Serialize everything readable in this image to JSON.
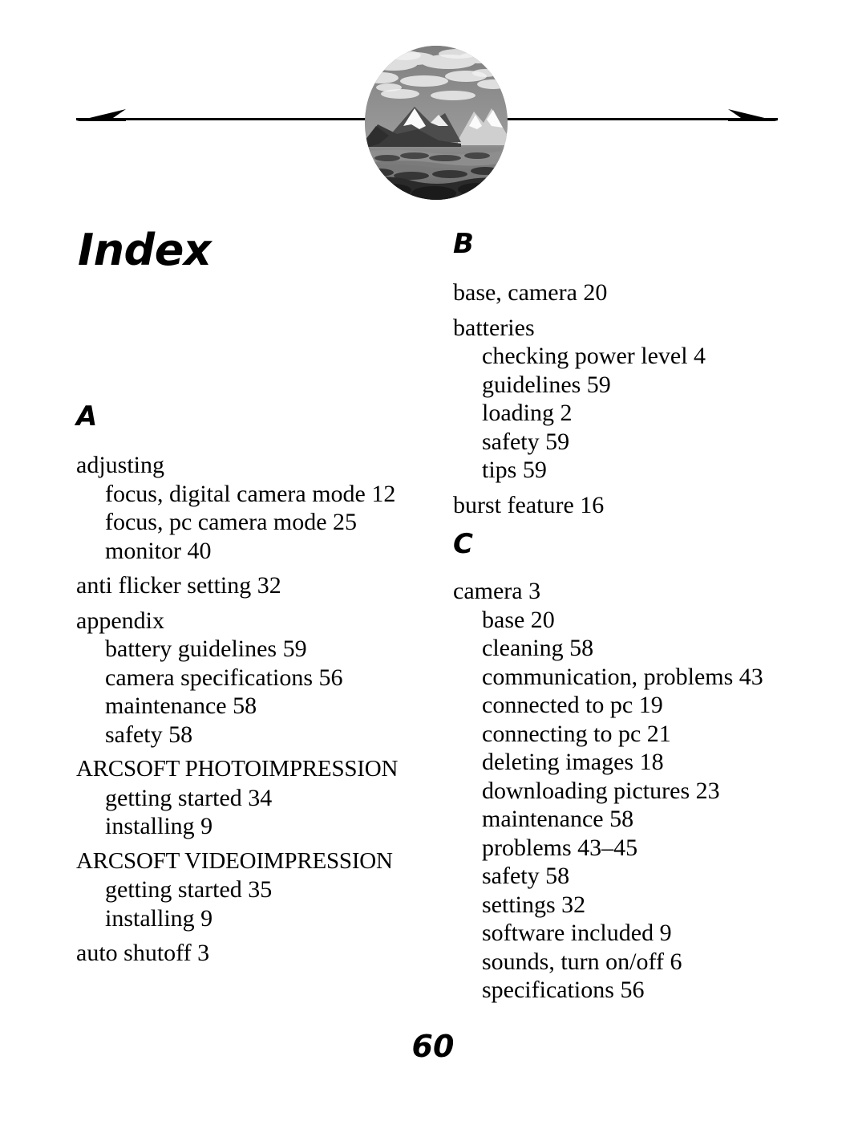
{
  "header": {
    "photo_alt": "mountain-landscape-photo",
    "left_arrow": "arrow-left",
    "right_arrow": "arrow-right"
  },
  "title": "Index",
  "page_number": "60",
  "columns": {
    "left": {
      "sections": [
        {
          "letter": "A",
          "groups": [
            {
              "entries": [
                {
                  "level": 1,
                  "text": "adjusting"
                },
                {
                  "level": 2,
                  "text": "focus, digital camera mode 12"
                },
                {
                  "level": 2,
                  "text": "focus, pc camera mode 25"
                },
                {
                  "level": 2,
                  "text": "monitor 40"
                }
              ]
            },
            {
              "entries": [
                {
                  "level": 1,
                  "text": "anti flicker setting 32"
                }
              ]
            },
            {
              "entries": [
                {
                  "level": 1,
                  "text": "appendix"
                },
                {
                  "level": 2,
                  "text": "battery guidelines 59"
                },
                {
                  "level": 2,
                  "text": "camera specifications 56"
                },
                {
                  "level": 2,
                  "text": "maintenance 58"
                },
                {
                  "level": 2,
                  "text": "safety 58"
                }
              ]
            },
            {
              "entries": [
                {
                  "level": 1,
                  "text": "ARCSOFT PHOTOIMPRESSION",
                  "caps": true
                },
                {
                  "level": 2,
                  "text": "getting started 34"
                },
                {
                  "level": 2,
                  "text": "installing 9"
                }
              ]
            },
            {
              "entries": [
                {
                  "level": 1,
                  "text": "ARCSOFT VIDEOIMPRESSION",
                  "caps": true
                },
                {
                  "level": 2,
                  "text": "getting started 35"
                },
                {
                  "level": 2,
                  "text": "installing 9"
                }
              ]
            },
            {
              "entries": [
                {
                  "level": 1,
                  "text": "auto shutoff 3"
                }
              ]
            }
          ]
        }
      ]
    },
    "right": {
      "sections": [
        {
          "letter": "B",
          "groups": [
            {
              "entries": [
                {
                  "level": 1,
                  "text": "base, camera 20"
                }
              ]
            },
            {
              "entries": [
                {
                  "level": 1,
                  "text": "batteries"
                },
                {
                  "level": 2,
                  "text": "checking power level 4"
                },
                {
                  "level": 2,
                  "text": "guidelines 59"
                },
                {
                  "level": 2,
                  "text": "loading 2"
                },
                {
                  "level": 2,
                  "text": "safety 59"
                },
                {
                  "level": 2,
                  "text": "tips 59"
                }
              ]
            },
            {
              "entries": [
                {
                  "level": 1,
                  "text": "burst feature 16"
                }
              ]
            }
          ]
        },
        {
          "letter": "C",
          "groups": [
            {
              "entries": [
                {
                  "level": 1,
                  "text": "camera 3"
                },
                {
                  "level": 2,
                  "text": "base 20"
                },
                {
                  "level": 2,
                  "text": "cleaning 58"
                },
                {
                  "level": 2,
                  "text": "communication, problems 43"
                },
                {
                  "level": 2,
                  "text": "connected to pc 19"
                },
                {
                  "level": 2,
                  "text": "connecting to pc 21"
                },
                {
                  "level": 2,
                  "text": "deleting images 18"
                },
                {
                  "level": 2,
                  "text": "downloading pictures 23"
                },
                {
                  "level": 2,
                  "text": "maintenance 58"
                },
                {
                  "level": 2,
                  "text": "problems 43–45"
                },
                {
                  "level": 2,
                  "text": "safety 58"
                },
                {
                  "level": 2,
                  "text": "settings 32"
                },
                {
                  "level": 2,
                  "text": "software included 9"
                },
                {
                  "level": 2,
                  "text": "sounds, turn on/off 6"
                },
                {
                  "level": 2,
                  "text": "specifications 56"
                }
              ]
            }
          ]
        }
      ]
    }
  }
}
